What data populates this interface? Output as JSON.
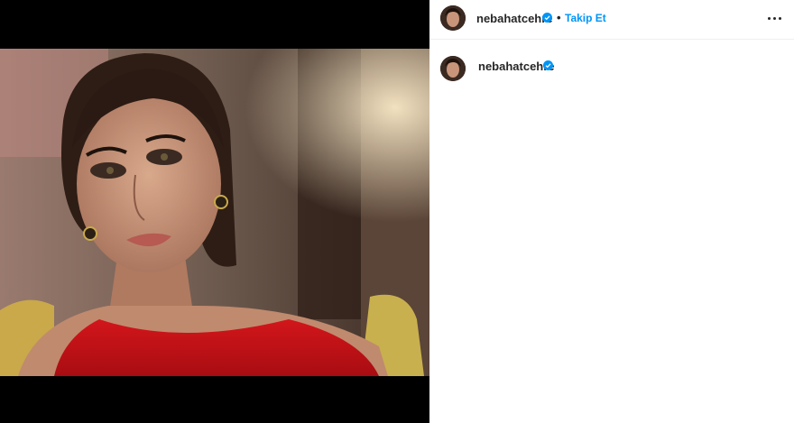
{
  "post": {
    "username": "nebahatcehre",
    "separator": "•",
    "follow_label": "Takip Et"
  },
  "caption": {
    "username": "nebahatcehre"
  },
  "colors": {
    "follow": "#0095f6",
    "verified": "#0095f6",
    "text": "#262626"
  },
  "icons": {
    "verified": "verified-badge-icon",
    "more": "more-options-icon"
  }
}
